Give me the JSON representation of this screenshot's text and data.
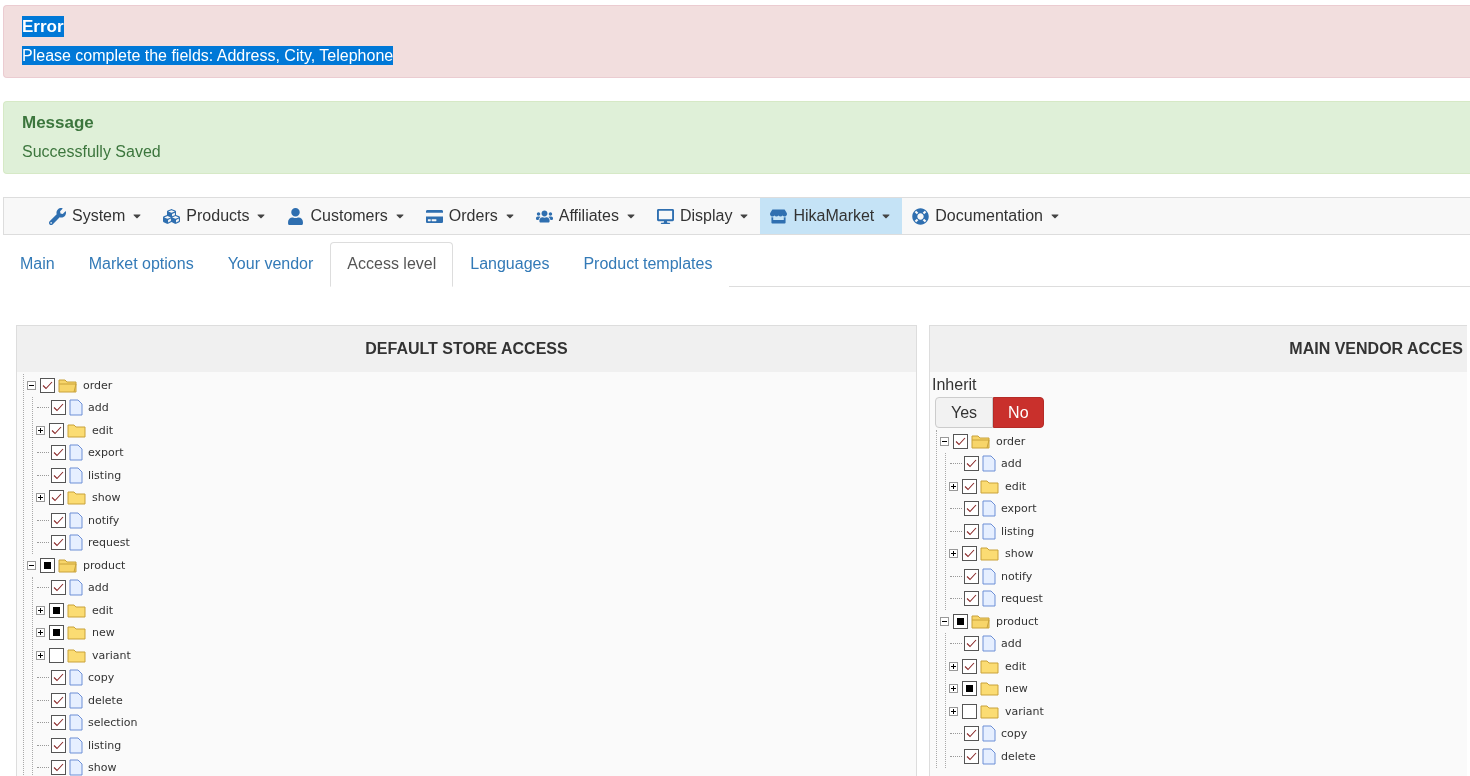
{
  "alerts": [
    {
      "kind": "error",
      "title": "Error",
      "text": "Please complete the fields: Address, City, Telephone",
      "highlighted": true
    },
    {
      "kind": "success",
      "title": "Message",
      "text": "Successfully Saved",
      "highlighted": false
    }
  ],
  "menu": [
    {
      "label": "System",
      "selected": false
    },
    {
      "label": "Products",
      "selected": false
    },
    {
      "label": "Customers",
      "selected": false
    },
    {
      "label": "Orders",
      "selected": false
    },
    {
      "label": "Affiliates",
      "selected": false
    },
    {
      "label": "Display",
      "selected": false
    },
    {
      "label": "HikaMarket",
      "selected": true
    },
    {
      "label": "Documentation",
      "selected": false
    }
  ],
  "tabs": [
    {
      "label": "Main",
      "selected": false
    },
    {
      "label": "Market options",
      "selected": false
    },
    {
      "label": "Your vendor",
      "selected": false
    },
    {
      "label": "Access level",
      "selected": true
    },
    {
      "label": "Languages",
      "selected": false
    },
    {
      "label": "Product templates",
      "selected": false
    }
  ],
  "panels": [
    {
      "title": "DEFAULT STORE ACCESS",
      "tree": [
        {
          "label": "order",
          "kind": "folder",
          "checked": true,
          "partial": false,
          "expanded": true,
          "children": [
            {
              "label": "add",
              "kind": "file",
              "checked": true,
              "partial": false
            },
            {
              "label": "edit",
              "kind": "folder",
              "checked": true,
              "partial": false,
              "expanded": false
            },
            {
              "label": "export",
              "kind": "file",
              "checked": true,
              "partial": false
            },
            {
              "label": "listing",
              "kind": "file",
              "checked": true,
              "partial": false
            },
            {
              "label": "show",
              "kind": "folder",
              "checked": true,
              "partial": false,
              "expanded": false
            },
            {
              "label": "notify",
              "kind": "file",
              "checked": true,
              "partial": false
            },
            {
              "label": "request",
              "kind": "file",
              "checked": true,
              "partial": false
            }
          ]
        },
        {
          "label": "product",
          "kind": "folder",
          "checked": false,
          "partial": true,
          "expanded": true,
          "children": [
            {
              "label": "add",
              "kind": "file",
              "checked": true,
              "partial": false
            },
            {
              "label": "edit",
              "kind": "folder",
              "checked": false,
              "partial": true,
              "expanded": false
            },
            {
              "label": "new",
              "kind": "folder",
              "checked": false,
              "partial": true,
              "expanded": false
            },
            {
              "label": "variant",
              "kind": "folder",
              "checked": false,
              "partial": false,
              "expanded": false
            },
            {
              "label": "copy",
              "kind": "file",
              "checked": true,
              "partial": false
            },
            {
              "label": "delete",
              "kind": "file",
              "checked": true,
              "partial": false
            },
            {
              "label": "selection",
              "kind": "file",
              "checked": true,
              "partial": false
            },
            {
              "label": "listing",
              "kind": "file",
              "checked": true,
              "partial": false
            },
            {
              "label": "show",
              "kind": "file",
              "checked": true,
              "partial": false
            }
          ]
        }
      ]
    },
    {
      "title": "MAIN VENDOR ACCES",
      "inherit": {
        "label": "Inherit",
        "options": [
          {
            "label": "Yes",
            "selected": false
          },
          {
            "label": "No",
            "selected": true
          }
        ]
      },
      "tree": [
        {
          "label": "order",
          "kind": "folder",
          "checked": true,
          "partial": false,
          "expanded": true,
          "children": [
            {
              "label": "add",
              "kind": "file",
              "checked": true,
              "partial": false
            },
            {
              "label": "edit",
              "kind": "folder",
              "checked": true,
              "partial": false,
              "expanded": false
            },
            {
              "label": "export",
              "kind": "file",
              "checked": true,
              "partial": false
            },
            {
              "label": "listing",
              "kind": "file",
              "checked": true,
              "partial": false
            },
            {
              "label": "show",
              "kind": "folder",
              "checked": true,
              "partial": false,
              "expanded": false
            },
            {
              "label": "notify",
              "kind": "file",
              "checked": true,
              "partial": false
            },
            {
              "label": "request",
              "kind": "file",
              "checked": true,
              "partial": false
            }
          ]
        },
        {
          "label": "product",
          "kind": "folder",
          "checked": false,
          "partial": true,
          "expanded": true,
          "children": [
            {
              "label": "add",
              "kind": "file",
              "checked": true,
              "partial": false
            },
            {
              "label": "edit",
              "kind": "folder",
              "checked": true,
              "partial": false,
              "expanded": false
            },
            {
              "label": "new",
              "kind": "folder",
              "checked": false,
              "partial": true,
              "expanded": false
            },
            {
              "label": "variant",
              "kind": "folder",
              "checked": false,
              "partial": false,
              "expanded": false
            },
            {
              "label": "copy",
              "kind": "file",
              "checked": true,
              "partial": false
            },
            {
              "label": "delete",
              "kind": "file",
              "checked": true,
              "partial": false
            }
          ]
        }
      ]
    }
  ]
}
